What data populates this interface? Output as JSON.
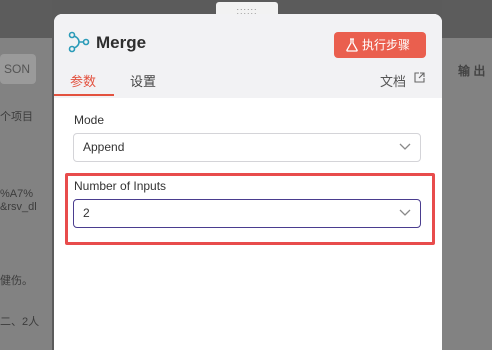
{
  "background": {
    "left_button": "SON",
    "left_lines": [
      "个项目",
      "%A7%",
      "&rsv_dl",
      "健伤。",
      "二、2人"
    ],
    "right_label": "输 出"
  },
  "drag_handle": "::::::",
  "panel": {
    "title": "Merge",
    "exec_button": "执行步骤",
    "tabs": [
      "参数",
      "设置"
    ],
    "docs_link": "文档",
    "fields": {
      "mode": {
        "label": "Mode",
        "value": "Append"
      },
      "number_of_inputs": {
        "label": "Number of Inputs",
        "value": "2"
      }
    }
  },
  "colors": {
    "accent": "#e3523f",
    "button": "#ea5f4e",
    "highlight": "#e84c4c",
    "focus_border": "#4a3d8f"
  }
}
